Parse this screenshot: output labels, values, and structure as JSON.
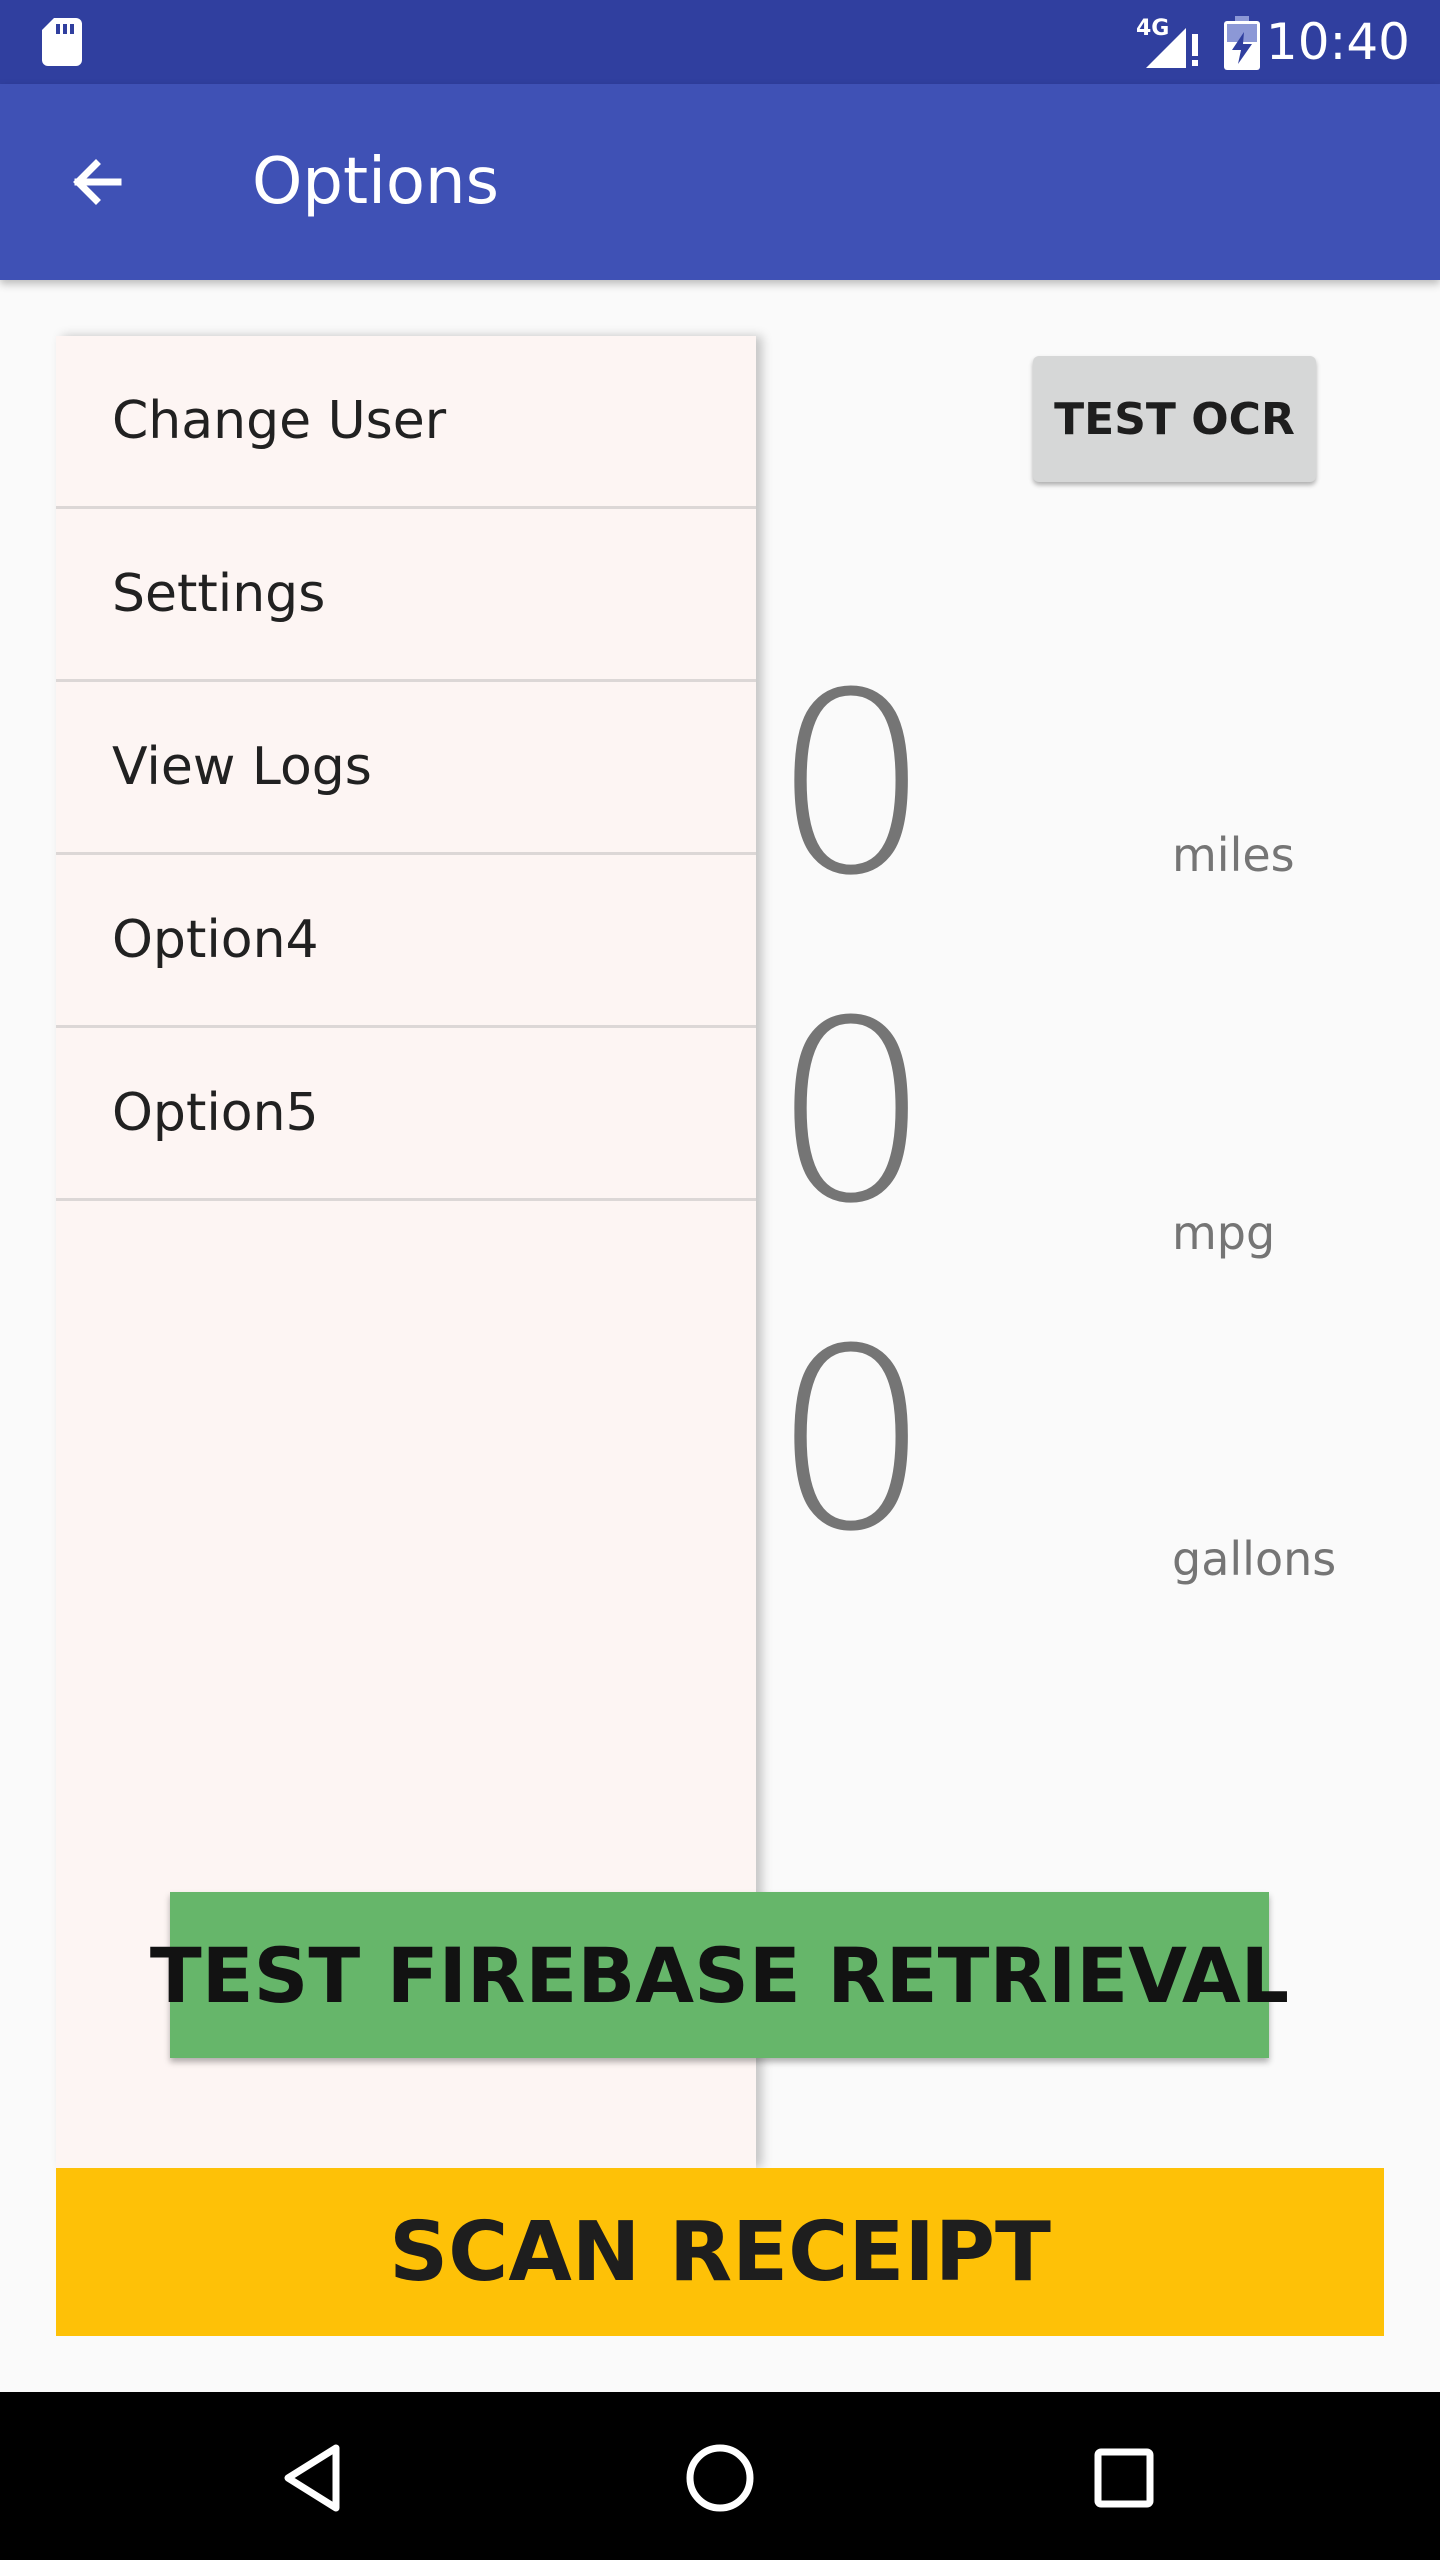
{
  "status_bar": {
    "network": "4G",
    "time": "10:40",
    "icons": [
      "sd-card-icon",
      "signal-icon",
      "battery-charging-icon"
    ]
  },
  "app_bar": {
    "title": "Options",
    "back_icon": "arrow-left-icon"
  },
  "drawer": {
    "items": [
      {
        "label": "Change User"
      },
      {
        "label": "Settings"
      },
      {
        "label": "View Logs"
      },
      {
        "label": "Option4"
      },
      {
        "label": "Option5"
      }
    ]
  },
  "main": {
    "test_ocr_label": "TEST OCR",
    "stats": [
      {
        "value": "0",
        "unit": "miles"
      },
      {
        "value": "0",
        "unit": "mpg"
      },
      {
        "value": "0",
        "unit": "gallons"
      }
    ],
    "firebase_label": "TEST FIREBASE RETRIEVAL",
    "scan_label": "SCAN RECEIPT"
  },
  "nav_bar": {
    "icons": [
      "back-triangle-icon",
      "home-circle-icon",
      "recents-square-icon"
    ]
  },
  "colors": {
    "status_bar": "#303f9f",
    "app_bar": "#3f51b5",
    "firebase_button": "#66b66a",
    "scan_button": "#fec107",
    "drawer_bg": "#fdf5f3"
  }
}
